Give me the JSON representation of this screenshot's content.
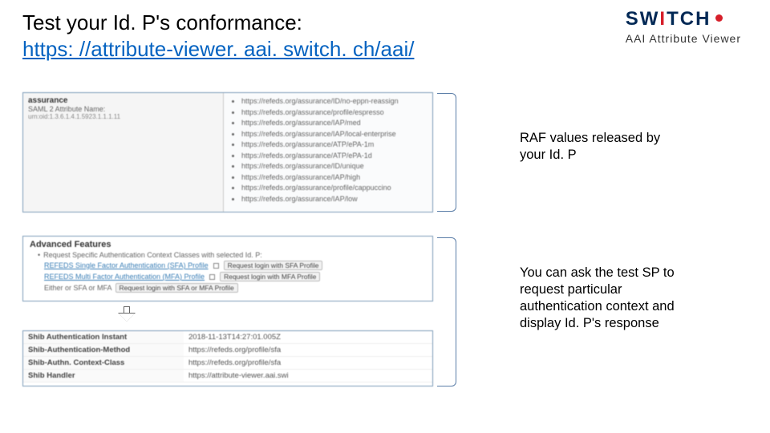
{
  "header": {
    "title": "Test your Id. P's conformance:",
    "link_text": "https: //attribute-viewer. aai. switch. ch/aai/",
    "link_href": "https://attribute-viewer.aai.switch.ch/aai/"
  },
  "logo": {
    "word_main": "SW",
    "word_accent": "I",
    "word_rest": "TCH",
    "subtitle": "AAI Attribute Viewer"
  },
  "panel1": {
    "label_bold": "assurance",
    "label_sub": "SAML 2 Attribute Name:",
    "label_oid": "urn:oid:1.3.6.1.4.1.5923.1.1.1.11",
    "values": [
      "https://refeds.org/assurance/ID/no-eppn-reassign",
      "https://refeds.org/assurance/profile/espresso",
      "https://refeds.org/assurance/IAP/med",
      "https://refeds.org/assurance/IAP/local-enterprise",
      "https://refeds.org/assurance/ATP/ePA-1m",
      "https://refeds.org/assurance/ATP/ePA-1d",
      "https://refeds.org/assurance/ID/unique",
      "https://refeds.org/assurance/IAP/high",
      "https://refeds.org/assurance/profile/cappuccino",
      "https://refeds.org/assurance/IAP/low"
    ]
  },
  "panel2": {
    "heading": "Advanced Features",
    "intro": "Request Specific Authentication Context Classes with selected Id. P:",
    "rows": [
      {
        "label": "REFEDS Single Factor Authentication (SFA) Profile",
        "button": "Request login with SFA Profile"
      },
      {
        "label": "REFEDS Multi Factor Authentication (MFA) Profile",
        "button": "Request login with MFA Profile"
      },
      {
        "label": "Either or SFA or MFA",
        "button": "Request login with SFA or MFA Profile"
      }
    ]
  },
  "panel3": {
    "rows": [
      {
        "k": "Shib Authentication Instant",
        "v": "2018-11-13T14:27:01.005Z"
      },
      {
        "k": "Shib-Authentication-Method",
        "v": "https://refeds.org/profile/sfa"
      },
      {
        "k": "Shib-Authn. Context-Class",
        "v": "https://refeds.org/profile/sfa"
      },
      {
        "k": "Shib Handler",
        "v": "https://attribute-viewer.aai.swi"
      }
    ]
  },
  "callouts": {
    "c1": "RAF values released by your Id. P",
    "c2": "You can ask the test SP to request particular authentication context and display Id. P's response"
  }
}
